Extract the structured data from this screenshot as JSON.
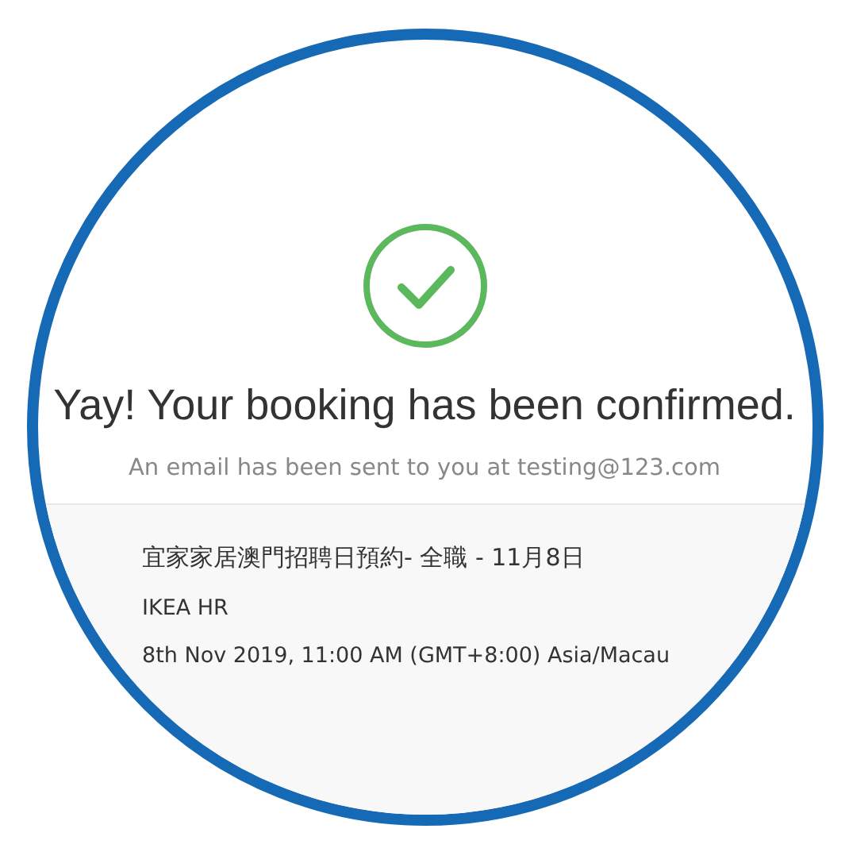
{
  "confirmation": {
    "heading": "Yay! Your booking has been confirmed.",
    "message": "An email has been sent to you at testing@123.com"
  },
  "booking": {
    "title": "宜家家居澳門招聘日預約- 全職 - 11月8日",
    "organizer": "IKEA HR",
    "datetime": "8th Nov 2019, 11:00 AM (GMT+8:00) Asia/Macau"
  }
}
